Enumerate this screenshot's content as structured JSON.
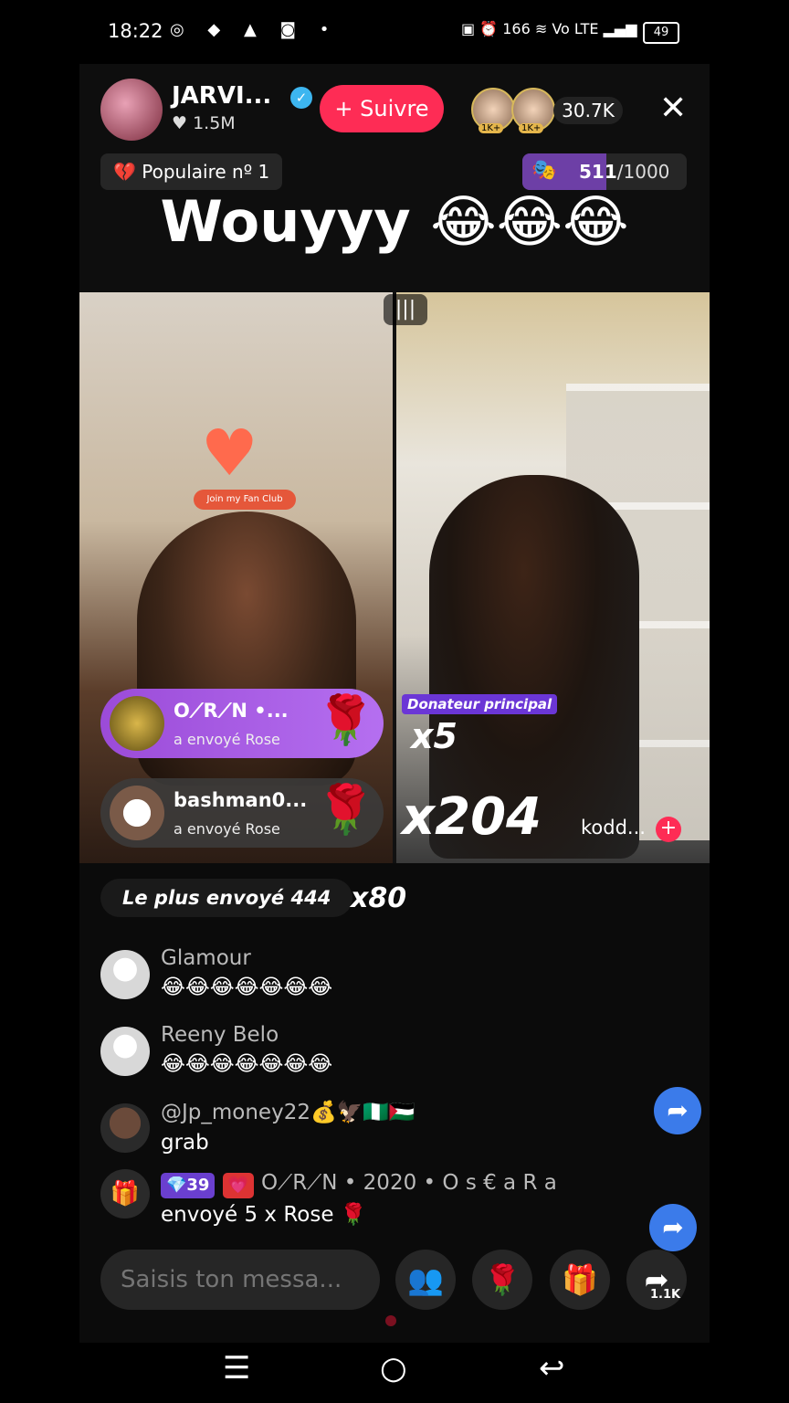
{
  "status_bar": {
    "time": "18:22",
    "left_icons": "◎ ◆ ▲ ◙ •",
    "right_text": "▣ ⏰ 166 ≋ Vo LTE ▂▄▆",
    "battery": "49"
  },
  "host": {
    "name": "JARVI...",
    "likes": "♥ 1.5M",
    "verified_icon": "✓",
    "follow_label": "+ Suivre"
  },
  "viewers": {
    "badge_1": "1K+",
    "badge_2": "1K+",
    "count": "30.7K"
  },
  "close_icon": "✕",
  "popular_label": "💔 Populaire nº 1",
  "goal": {
    "current": "511",
    "total": "/1000",
    "fraction": 0.511
  },
  "headline": "Wouyyy 😂😂😂",
  "fan_club_label": "Join my Fan Club",
  "gift_toasts": [
    {
      "name": "O⟋R⟋N •...",
      "sub": "a envoyé  Rose",
      "gift": "🌹"
    },
    {
      "name": "bashman0...",
      "sub": "a envoyé  Rose",
      "gift": "🌹"
    }
  ],
  "top_donor_label": "Donateur principal",
  "multiplier_small": "x5",
  "multiplier_big": "x204",
  "right_host": "kodd...",
  "most_sent": "Le plus envoyé 444",
  "most_sent_mult": "x80",
  "chat": [
    {
      "name": "Glamour",
      "text": "😂😂😂😂😂😂😂"
    },
    {
      "name": "Reeny Belo",
      "text": "😂😂😂😂😂😂😂"
    },
    {
      "name": "@Jp_money22💰🦅🇳🇬🇵🇸",
      "text": "grab"
    }
  ],
  "gift_event": {
    "level_badge": "💎39",
    "fan_badge": "💗",
    "user": "O⟋R⟋N • 2020 • O s € a R a",
    "message": "envoyé 5 x Rose 🌹"
  },
  "bottom_bar": {
    "input_placeholder": "Saisis ton messa...",
    "share_count": "1.1K"
  },
  "icons": {
    "gift": "🎁",
    "rose": "🌹",
    "people": "👥",
    "share": "➦",
    "nav_menu": "☰",
    "nav_home": "○",
    "nav_back": "↩"
  }
}
